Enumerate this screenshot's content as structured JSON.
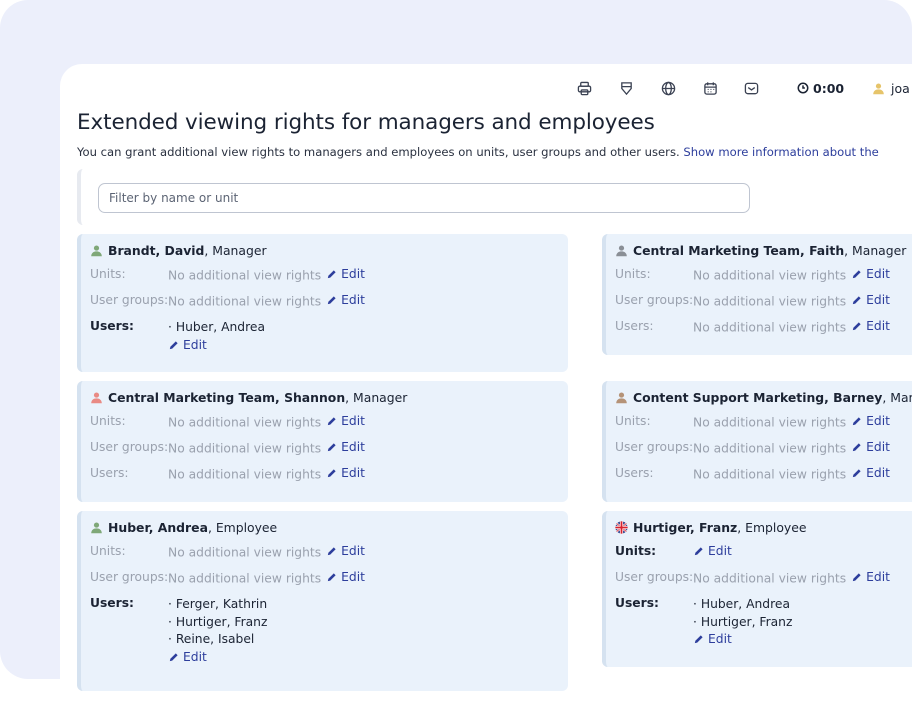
{
  "topbar": {
    "icons": [
      "printer-icon",
      "badge-icon",
      "globe-icon",
      "calendar-icon",
      "inbox-icon"
    ],
    "timer": "0:00",
    "user": "joa"
  },
  "page": {
    "title": "Extended viewing rights for managers and employees",
    "intro": "You can grant additional view rights to managers and employees on units, user groups and other users.",
    "intro_link": "Show more information about the"
  },
  "filter": {
    "placeholder": "Filter by name or unit"
  },
  "labels": {
    "units": "Units:",
    "groups": "User groups:",
    "users": "Users:",
    "edit": "Edit",
    "none": "No additional view rights"
  },
  "colors": {
    "accent": "#2d3e9c",
    "card_bg": "#eaf2fb"
  },
  "cards": [
    {
      "name": "Brandt, David",
      "role": ", Manager",
      "avatar": "green",
      "units": "No additional view rights",
      "groups": "No additional view rights",
      "users": [
        "· Huber, Andrea"
      ]
    },
    {
      "name": "Central Marketing Team, Faith",
      "role": ", Manager",
      "avatar": "gray",
      "units": "No additional view rights",
      "groups": "No additional view rights",
      "users_none": "No additional view rights"
    },
    {
      "name": "Central Marketing Team, Shannon",
      "role": ", Manager",
      "avatar": "pink",
      "units": "No additional view rights",
      "groups": "No additional view rights",
      "users_none": "No additional view rights"
    },
    {
      "name": "Content Support Marketing, Barney",
      "role": ", Manage",
      "avatar": "tan",
      "units": "No additional view rights",
      "groups": "No additional view rights",
      "users_none": "No additional view rights"
    },
    {
      "name": "Huber, Andrea",
      "role": ", Employee",
      "avatar": "green",
      "units": "No additional view rights",
      "groups": "No additional view rights",
      "users": [
        "· Ferger, Kathrin",
        "· Hurtiger, Franz",
        "· Reine, Isabel"
      ]
    },
    {
      "name": "Hurtiger, Franz",
      "role": ", Employee",
      "avatar": "uk-flag",
      "groups": "No additional view rights",
      "users": [
        "· Huber, Andrea",
        "· Hurtiger, Franz"
      ]
    }
  ]
}
